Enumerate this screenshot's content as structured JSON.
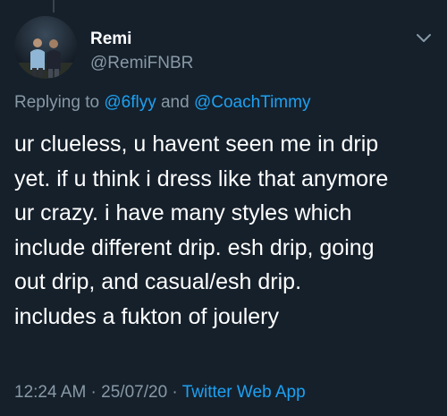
{
  "tweet": {
    "author": {
      "display_name": "Remi",
      "handle": "@RemiFNBR",
      "avatar_icon": "profile-photo-icon"
    },
    "reply": {
      "prefix": "Replying to ",
      "mention_1": "@6flyy",
      "connector": " and ",
      "mention_2": "@CoachTimmy"
    },
    "text_lines": [
      "ur clueless, u havent seen me in drip",
      "yet. if u think i dress like that anymore",
      "ur crazy. i have many styles which",
      "include different drip. esh drip, going",
      "out drip, and casual/esh drip.",
      "includes a fukton of joulery"
    ],
    "time": "12:24 AM",
    "separator_1": " · ",
    "date": "25/07/20",
    "separator_2": " · ",
    "source": "Twitter Web App",
    "menu_icon": "chevron-down-icon"
  },
  "colors": {
    "background": "#15202b",
    "primary_text": "#ffffff",
    "secondary_text": "#8899a6",
    "accent": "#1da1f2",
    "thread_line": "#38444d"
  }
}
